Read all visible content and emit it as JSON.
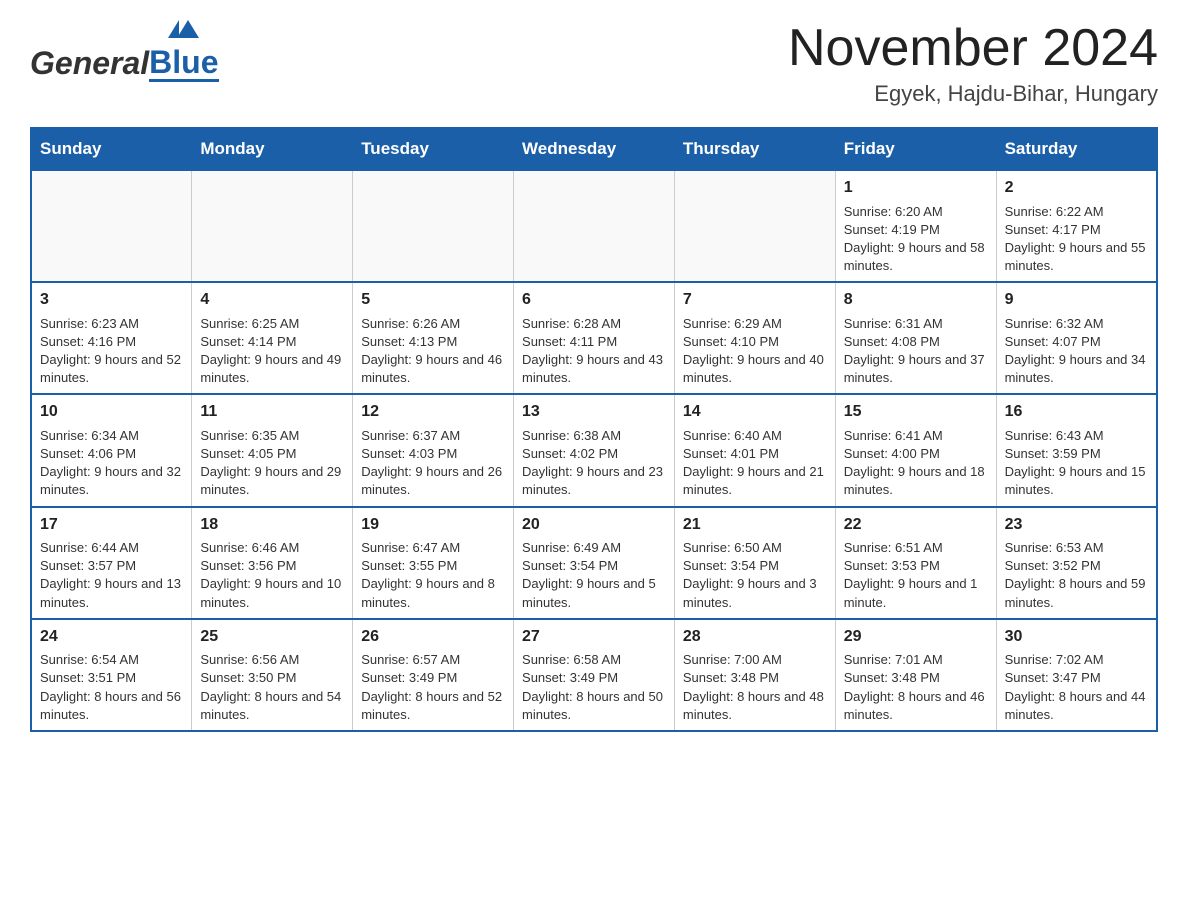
{
  "header": {
    "logo_general": "General",
    "logo_blue": "Blue",
    "month_title": "November 2024",
    "location": "Egyek, Hajdu-Bihar, Hungary"
  },
  "days_of_week": [
    "Sunday",
    "Monday",
    "Tuesday",
    "Wednesday",
    "Thursday",
    "Friday",
    "Saturday"
  ],
  "weeks": [
    [
      {
        "day": "",
        "info": ""
      },
      {
        "day": "",
        "info": ""
      },
      {
        "day": "",
        "info": ""
      },
      {
        "day": "",
        "info": ""
      },
      {
        "day": "",
        "info": ""
      },
      {
        "day": "1",
        "info": "Sunrise: 6:20 AM\nSunset: 4:19 PM\nDaylight: 9 hours and 58 minutes."
      },
      {
        "day": "2",
        "info": "Sunrise: 6:22 AM\nSunset: 4:17 PM\nDaylight: 9 hours and 55 minutes."
      }
    ],
    [
      {
        "day": "3",
        "info": "Sunrise: 6:23 AM\nSunset: 4:16 PM\nDaylight: 9 hours and 52 minutes."
      },
      {
        "day": "4",
        "info": "Sunrise: 6:25 AM\nSunset: 4:14 PM\nDaylight: 9 hours and 49 minutes."
      },
      {
        "day": "5",
        "info": "Sunrise: 6:26 AM\nSunset: 4:13 PM\nDaylight: 9 hours and 46 minutes."
      },
      {
        "day": "6",
        "info": "Sunrise: 6:28 AM\nSunset: 4:11 PM\nDaylight: 9 hours and 43 minutes."
      },
      {
        "day": "7",
        "info": "Sunrise: 6:29 AM\nSunset: 4:10 PM\nDaylight: 9 hours and 40 minutes."
      },
      {
        "day": "8",
        "info": "Sunrise: 6:31 AM\nSunset: 4:08 PM\nDaylight: 9 hours and 37 minutes."
      },
      {
        "day": "9",
        "info": "Sunrise: 6:32 AM\nSunset: 4:07 PM\nDaylight: 9 hours and 34 minutes."
      }
    ],
    [
      {
        "day": "10",
        "info": "Sunrise: 6:34 AM\nSunset: 4:06 PM\nDaylight: 9 hours and 32 minutes."
      },
      {
        "day": "11",
        "info": "Sunrise: 6:35 AM\nSunset: 4:05 PM\nDaylight: 9 hours and 29 minutes."
      },
      {
        "day": "12",
        "info": "Sunrise: 6:37 AM\nSunset: 4:03 PM\nDaylight: 9 hours and 26 minutes."
      },
      {
        "day": "13",
        "info": "Sunrise: 6:38 AM\nSunset: 4:02 PM\nDaylight: 9 hours and 23 minutes."
      },
      {
        "day": "14",
        "info": "Sunrise: 6:40 AM\nSunset: 4:01 PM\nDaylight: 9 hours and 21 minutes."
      },
      {
        "day": "15",
        "info": "Sunrise: 6:41 AM\nSunset: 4:00 PM\nDaylight: 9 hours and 18 minutes."
      },
      {
        "day": "16",
        "info": "Sunrise: 6:43 AM\nSunset: 3:59 PM\nDaylight: 9 hours and 15 minutes."
      }
    ],
    [
      {
        "day": "17",
        "info": "Sunrise: 6:44 AM\nSunset: 3:57 PM\nDaylight: 9 hours and 13 minutes."
      },
      {
        "day": "18",
        "info": "Sunrise: 6:46 AM\nSunset: 3:56 PM\nDaylight: 9 hours and 10 minutes."
      },
      {
        "day": "19",
        "info": "Sunrise: 6:47 AM\nSunset: 3:55 PM\nDaylight: 9 hours and 8 minutes."
      },
      {
        "day": "20",
        "info": "Sunrise: 6:49 AM\nSunset: 3:54 PM\nDaylight: 9 hours and 5 minutes."
      },
      {
        "day": "21",
        "info": "Sunrise: 6:50 AM\nSunset: 3:54 PM\nDaylight: 9 hours and 3 minutes."
      },
      {
        "day": "22",
        "info": "Sunrise: 6:51 AM\nSunset: 3:53 PM\nDaylight: 9 hours and 1 minute."
      },
      {
        "day": "23",
        "info": "Sunrise: 6:53 AM\nSunset: 3:52 PM\nDaylight: 8 hours and 59 minutes."
      }
    ],
    [
      {
        "day": "24",
        "info": "Sunrise: 6:54 AM\nSunset: 3:51 PM\nDaylight: 8 hours and 56 minutes."
      },
      {
        "day": "25",
        "info": "Sunrise: 6:56 AM\nSunset: 3:50 PM\nDaylight: 8 hours and 54 minutes."
      },
      {
        "day": "26",
        "info": "Sunrise: 6:57 AM\nSunset: 3:49 PM\nDaylight: 8 hours and 52 minutes."
      },
      {
        "day": "27",
        "info": "Sunrise: 6:58 AM\nSunset: 3:49 PM\nDaylight: 8 hours and 50 minutes."
      },
      {
        "day": "28",
        "info": "Sunrise: 7:00 AM\nSunset: 3:48 PM\nDaylight: 8 hours and 48 minutes."
      },
      {
        "day": "29",
        "info": "Sunrise: 7:01 AM\nSunset: 3:48 PM\nDaylight: 8 hours and 46 minutes."
      },
      {
        "day": "30",
        "info": "Sunrise: 7:02 AM\nSunset: 3:47 PM\nDaylight: 8 hours and 44 minutes."
      }
    ]
  ]
}
